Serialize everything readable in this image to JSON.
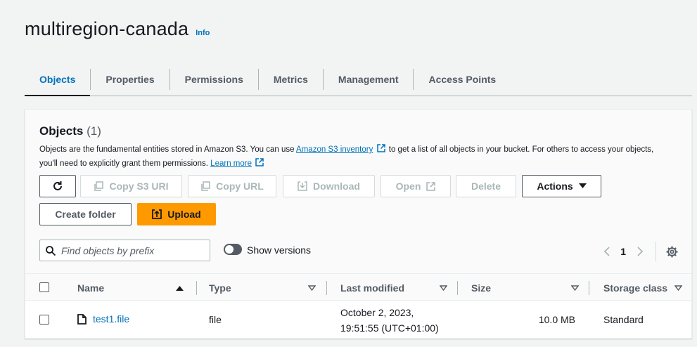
{
  "page": {
    "title": "multiregion-canada",
    "info_link": "Info"
  },
  "tabs": [
    "Objects",
    "Properties",
    "Permissions",
    "Metrics",
    "Management",
    "Access Points"
  ],
  "objects_section": {
    "title": "Objects",
    "count": "(1)",
    "description_part1": "Objects are the fundamental entities stored in Amazon S3. You can use ",
    "inventory_link": "Amazon S3 inventory",
    "description_part2": " to get a list of all objects in your bucket. For others to access your objects, you'll need to explicitly grant them permissions. ",
    "learn_more": "Learn more"
  },
  "toolbar": {
    "copy_s3_uri": "Copy S3 URI",
    "copy_url": "Copy URL",
    "download": "Download",
    "open": "Open",
    "delete": "Delete",
    "actions": "Actions",
    "create_folder": "Create folder",
    "upload": "Upload"
  },
  "search": {
    "placeholder": "Find objects by prefix"
  },
  "show_versions": {
    "label": "Show versions",
    "enabled": false
  },
  "pagination": {
    "current_page": "1"
  },
  "table": {
    "columns": [
      "Name",
      "Type",
      "Last modified",
      "Size",
      "Storage class"
    ],
    "rows": [
      {
        "name": "test1.file",
        "type": "file",
        "last_modified_line1": "October 2, 2023,",
        "last_modified_line2": "19:51:55 (UTC+01:00)",
        "size": "10.0 MB",
        "storage_class": "Standard"
      }
    ]
  },
  "colors": {
    "accent": "#0073bb",
    "primary_button": "#ff9900",
    "text": "#16191f",
    "muted": "#545b64"
  }
}
